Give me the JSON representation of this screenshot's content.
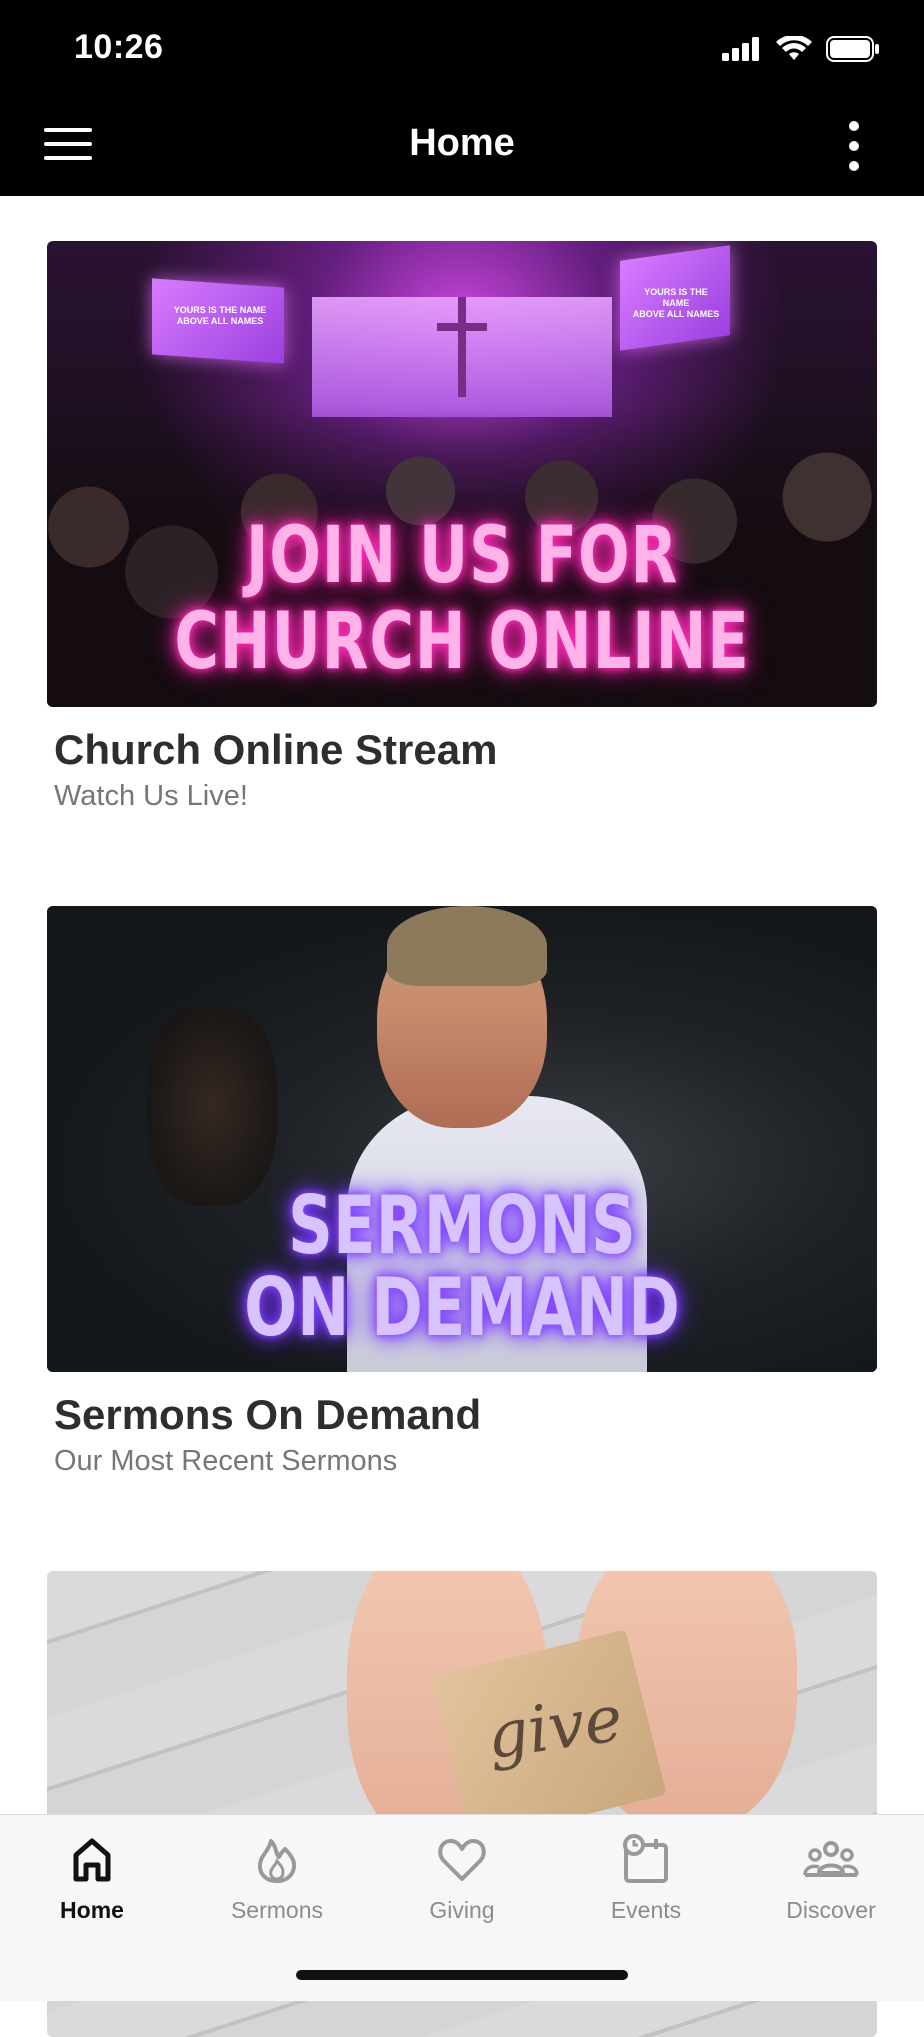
{
  "status_bar": {
    "time": "10:26",
    "icons": [
      "signal-icon",
      "wifi-icon",
      "battery-icon"
    ]
  },
  "header": {
    "title": "Home",
    "left_icon": "hamburger-menu-icon",
    "right_icon": "more-vertical-icon"
  },
  "cards": [
    {
      "title": "Church Online Stream",
      "subtitle": "Watch Us Live!",
      "image_text": [
        "JOIN US FOR",
        "CHURCH ONLINE"
      ],
      "screen_text": [
        "YOURS IS THE NAME",
        "ABOVE ALL NAMES"
      ]
    },
    {
      "title": "Sermons On Demand",
      "subtitle": "Our Most Recent Sermons",
      "image_text": [
        "SERMONS",
        "ON DEMAND"
      ]
    },
    {
      "title": "",
      "subtitle": "",
      "image_text": [
        "give"
      ]
    }
  ],
  "tabs": [
    {
      "label": "Home",
      "icon": "home-icon",
      "active": true
    },
    {
      "label": "Sermons",
      "icon": "flame-icon",
      "active": false
    },
    {
      "label": "Giving",
      "icon": "heart-icon",
      "active": false
    },
    {
      "label": "Events",
      "icon": "calendar-clock-icon",
      "active": false
    },
    {
      "label": "Discover",
      "icon": "people-icon",
      "active": false
    }
  ],
  "colors": {
    "header_bg": "#000000",
    "tab_active": "#111111",
    "tab_inactive": "#8c8c8c",
    "neon_pink": "#ff2fb8",
    "neon_purple": "#7a38ff"
  }
}
